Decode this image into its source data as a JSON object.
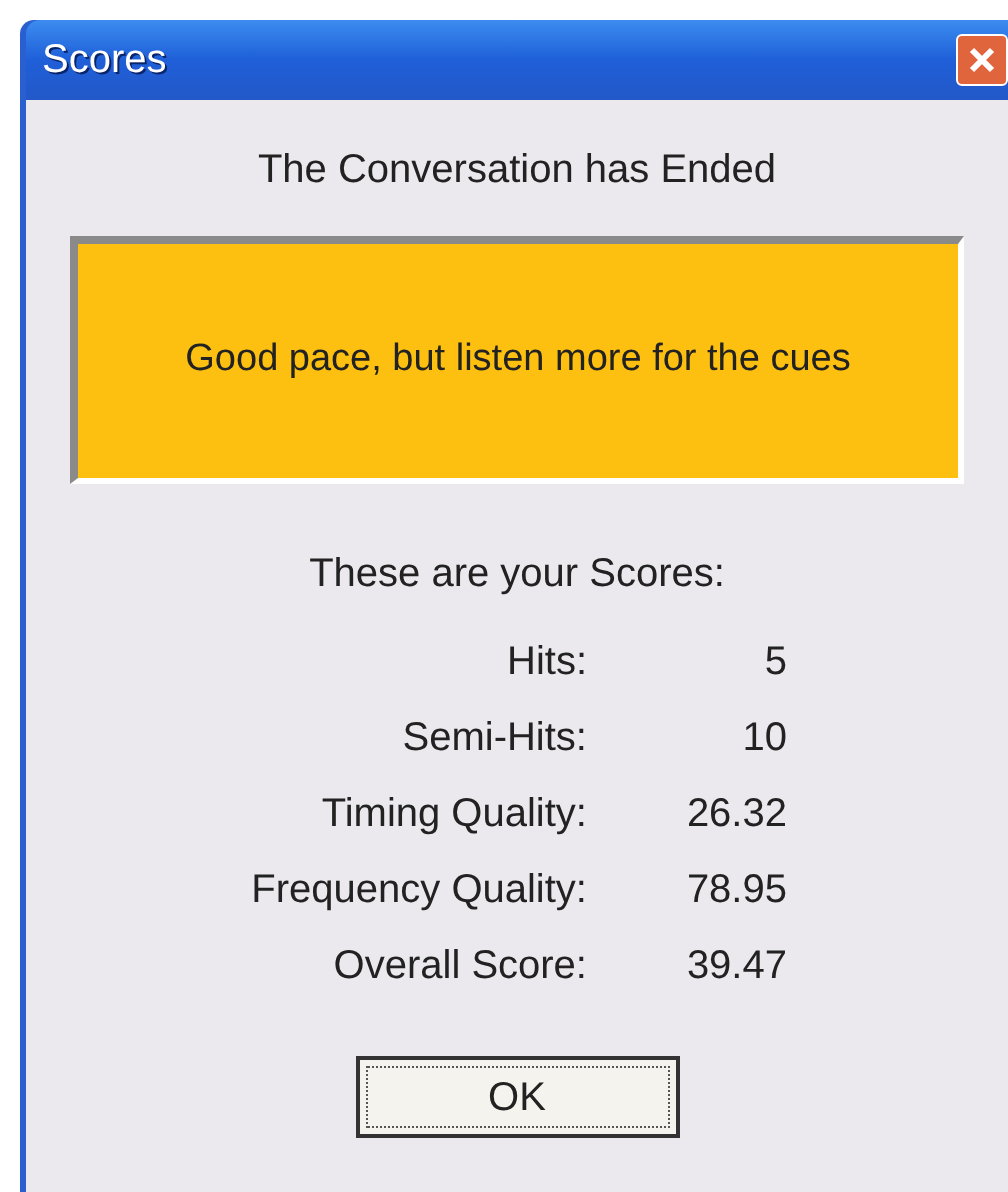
{
  "window": {
    "title": "Scores"
  },
  "heading": "The Conversation has Ended",
  "feedback": {
    "text": "Good pace, but listen more for the cues",
    "color": "#fdc010"
  },
  "scores_title": "These are your Scores:",
  "scores": [
    {
      "label": "Hits:",
      "value": "5"
    },
    {
      "label": "Semi-Hits:",
      "value": "10"
    },
    {
      "label": "Timing Quality:",
      "value": "26.32"
    },
    {
      "label": "Frequency Quality:",
      "value": "78.95"
    },
    {
      "label": "Overall Score:",
      "value": "39.47"
    }
  ],
  "buttons": [
    {
      "label": "OK",
      "focused": true
    }
  ]
}
